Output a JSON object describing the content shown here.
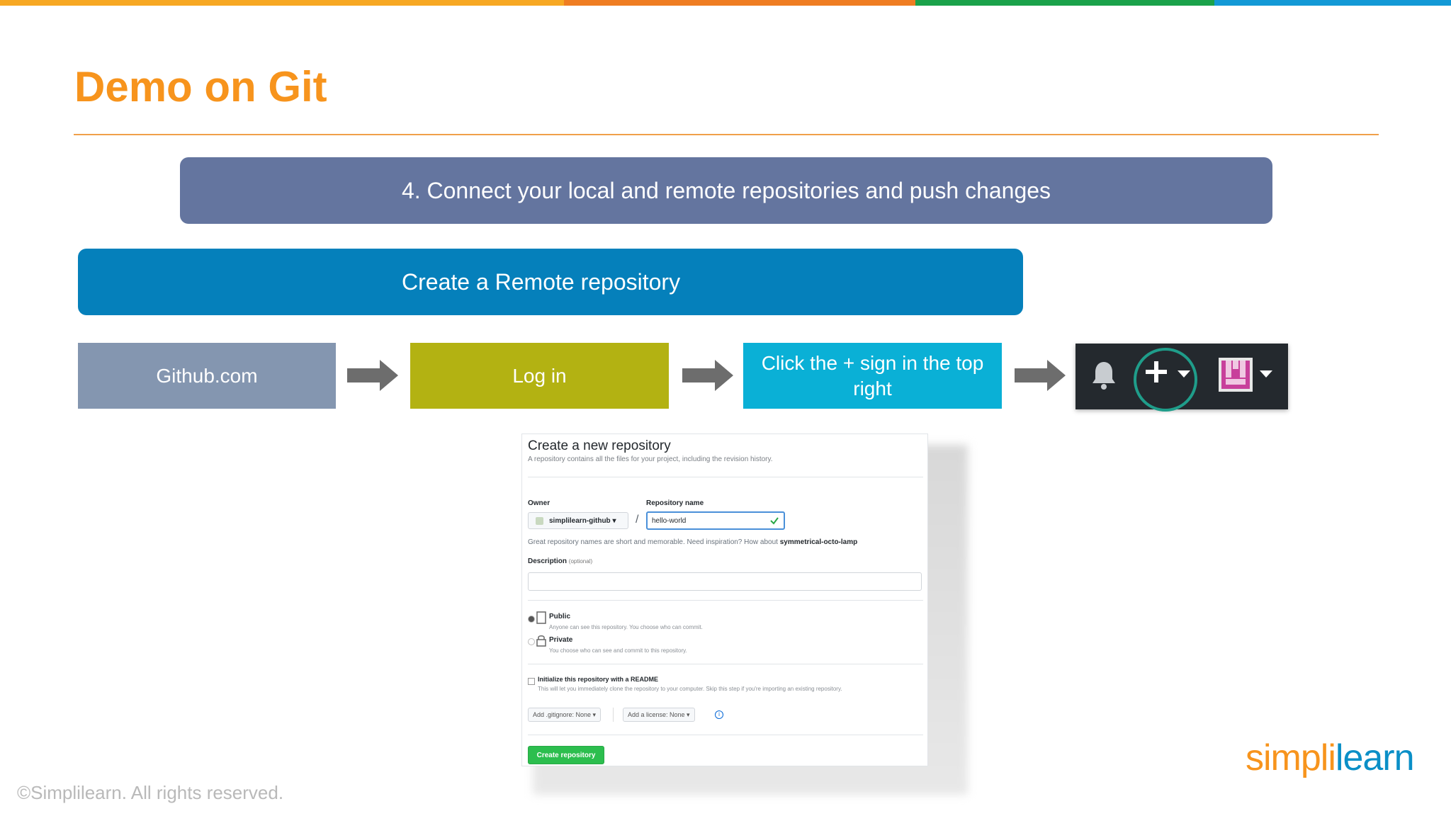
{
  "slide": {
    "title": "Demo on Git",
    "step_banner": "4. Connect your local and remote repositories and push changes",
    "sub_banner": "Create a Remote repository",
    "flow": [
      "Github.com",
      "Log in",
      "Click the + sign in the top right"
    ],
    "copyright": "©Simplilearn. All rights reserved.",
    "logo_part1": "simpli",
    "logo_part2": "learn"
  },
  "colors": {
    "title": "#f7941d",
    "step_banner": "#64759f",
    "sub_banner": "#0580bb",
    "box1": "#8496b0",
    "box2": "#b3b212",
    "box3": "#0ab0d6",
    "navbar": "#24292e",
    "highlight_ring": "#1f9d8a"
  },
  "navbar_icons": [
    "bell-icon",
    "plus-icon",
    "caret-down-icon",
    "avatar-icon",
    "caret-down-icon"
  ],
  "github_form": {
    "title": "Create a new repository",
    "subtitle": "A repository contains all the files for your project, including the revision history.",
    "owner_label": "Owner",
    "owner_value": "simplilearn-github ▾",
    "repo_label": "Repository name",
    "repo_value": "hello-world",
    "hint_prefix": "Great repository names are short and memorable. Need inspiration? How about ",
    "hint_suggestion": "symmetrical-octo-lamp",
    "description_label": "Description",
    "description_optional": "(optional)",
    "public_label": "Public",
    "public_sub": "Anyone can see this repository. You choose who can commit.",
    "private_label": "Private",
    "private_sub": "You choose who can see and commit to this repository.",
    "readme_label": "Initialize this repository with a README",
    "readme_sub": "This will let you immediately clone the repository to your computer. Skip this step if you're importing an existing repository.",
    "gitignore": "Add .gitignore: None ▾",
    "license": "Add a license: None ▾",
    "info": "i",
    "create_button": "Create repository"
  }
}
